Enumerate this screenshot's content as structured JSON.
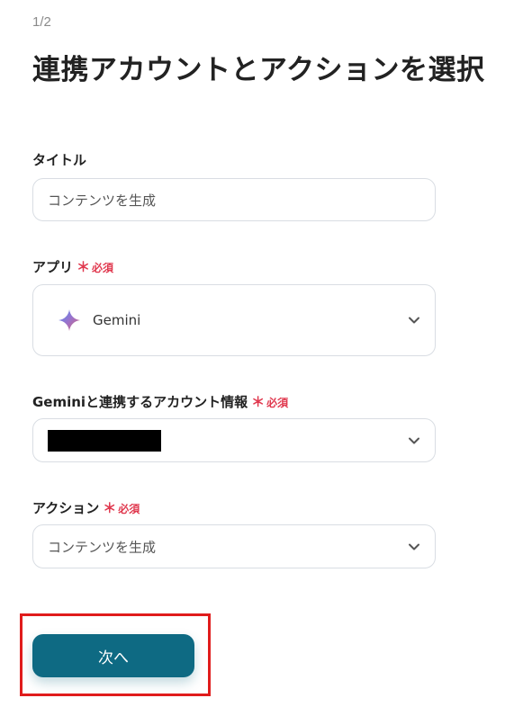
{
  "header": {
    "step": "1/2",
    "title": "連携アカウントとアクションを選択"
  },
  "required_mark": "＊",
  "required_text": "必須",
  "fields": {
    "title": {
      "label": "タイトル",
      "value": "コンテンツを生成"
    },
    "app": {
      "label": "アプリ",
      "value": "Gemini",
      "icon": "gemini-sparkle-icon"
    },
    "account": {
      "label": "Geminiと連携するアカウント情報",
      "value": "[redacted]"
    },
    "action": {
      "label": "アクション",
      "value": "コンテンツを生成"
    }
  },
  "buttons": {
    "next": "次へ"
  },
  "colors": {
    "accent": "#0e6a83",
    "required": "#e0384e",
    "highlight": "#e01c1c",
    "border": "#d9dde3"
  }
}
